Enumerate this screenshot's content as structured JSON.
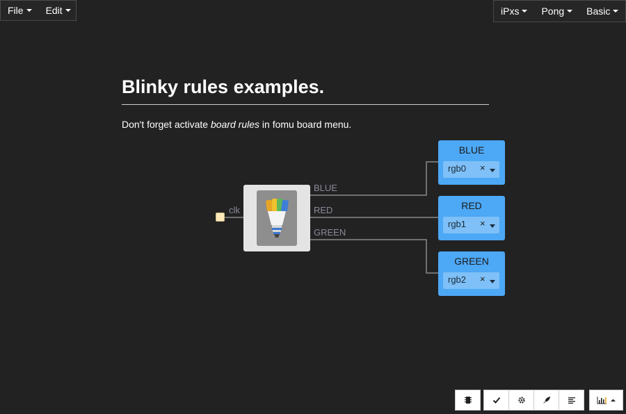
{
  "menu_left": [
    {
      "label": "File"
    },
    {
      "label": "Edit"
    }
  ],
  "menu_right": [
    {
      "label": "iPxs"
    },
    {
      "label": "Pong"
    },
    {
      "label": "Basic"
    }
  ],
  "title": "Blinky rules examples.",
  "note": {
    "before": "Don't forget activate ",
    "emph": "board rules",
    "after": " in fomu board menu."
  },
  "input": {
    "label": "clk"
  },
  "wires": [
    {
      "label": "BLUE"
    },
    {
      "label": "RED"
    },
    {
      "label": "GREEN"
    }
  ],
  "outputs": [
    {
      "title": "BLUE",
      "value": "rgb0",
      "clear": "×"
    },
    {
      "title": "RED",
      "value": "rgb1",
      "clear": "×"
    },
    {
      "title": "GREEN",
      "value": "rgb2",
      "clear": "×"
    }
  ],
  "toolbar": [
    {
      "icon": "chip-icon"
    },
    {
      "icon": "check-icon"
    },
    {
      "icon": "gear-icon"
    },
    {
      "icon": "rocket-icon"
    },
    {
      "icon": "align-left-icon"
    },
    {
      "icon": "bar-chart-icon"
    }
  ],
  "colors": {
    "background": "#222222",
    "output_block": "#4da8f5",
    "output_select": "#7ec0f7",
    "clk_port": "#fde9b8",
    "wire": "#8a8a8a"
  }
}
